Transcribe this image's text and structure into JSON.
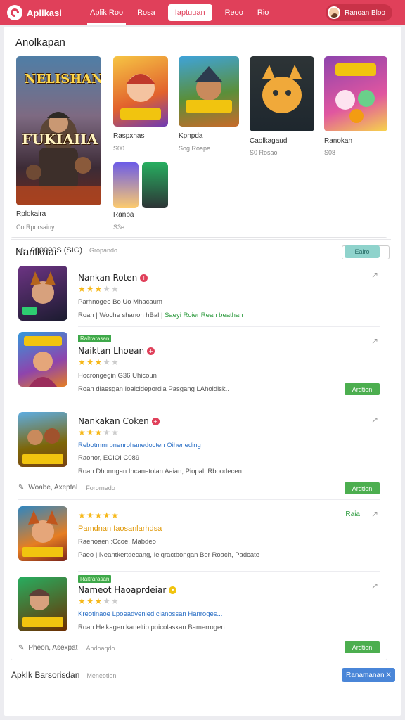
{
  "topbar": {
    "brand": "Aplikasi",
    "nav": [
      "Aplik Roo",
      "Rosa",
      "Iaptuuan",
      "Reoo",
      "Rio"
    ],
    "user": "Ranoan Bloo"
  },
  "featured": {
    "title": "Anolkapan",
    "big": {
      "art_title": "NELISHAN",
      "art_sub": "FUKIAIIA",
      "name": "Rplokaira",
      "meta": "Co Rporsainy"
    },
    "items": [
      {
        "name": "Raspxhas",
        "meta": "S00"
      },
      {
        "name": "Kpnpda",
        "meta": "Sog Roape"
      },
      {
        "name": "Caolkagaud",
        "meta": "S0 Rosao"
      },
      {
        "name": "Ranokan",
        "meta": "S08"
      },
      {
        "name": "Ranba",
        "meta": "S3e"
      }
    ]
  },
  "list": {
    "title": "Nanlkaai",
    "section_button": "Ranoidao",
    "header_text": "000000S (SIG)",
    "header_sub": "Grópando",
    "header_button": "Eairo",
    "rows": [
      {
        "title": "Nankan Roten",
        "rating": 3.5,
        "line1": "Parhnogeo Bo Uo Mhacaum",
        "line2_a": "Roan | Woche shanon hBal |",
        "line2_b": "Saeyi Roier Rean beathan"
      },
      {
        "tag": "Raltrarasan",
        "title": "Naiktan Lhoean",
        "rating": 3,
        "line1": "Hocrongegin G36 Uhicoun",
        "line2": "Roan dlaesgan Ioaicidepordia Pasgang LAhoidisk..",
        "button": "Ardtion"
      },
      {
        "title": "Nankakan Coken",
        "rating": 3,
        "line1": "Rebotmmrbnenrohanedocten Oiheneding",
        "line2": "Raonor, ECIOI C089",
        "line3": "Roan Dhonngan Incanetolan Aaian, Piopal, Rboodecen",
        "footer": "Woabe, Axeptal",
        "footer_sub": "Forornedo",
        "button": "Ardtion"
      },
      {
        "title_a": "Pamdnan",
        "title_b": "Iaosanlarhdsa",
        "rating": 5,
        "line1": "Raehoaen :Ccoe, Mabdeo",
        "line2": "Paeo | Neantkertdecang, Ieiqractbongan Ber Roach, Padcate",
        "tag_right": "Raia"
      },
      {
        "tag": "Raltrarasan",
        "title": "Nameot Haoaprdeiar",
        "rating": 3.5,
        "line1": "Kreotinaoe Lpoeadvenied cianossan Hanroges...",
        "line2": "Roan Heikagen kaneltio poicolaskan Bamerrogen",
        "footer": "Pheon, Asexpat",
        "footer_sub": "Ahdoaqdo",
        "button": "Ardtion"
      }
    ]
  },
  "bottom": {
    "title": "ApkIk Barsorisdan",
    "sub": "Meneotion",
    "button": "Ranamanan X"
  },
  "colors": {
    "brand": "#e0405a",
    "star": "#f6b81a",
    "green": "#4cae4f",
    "blue": "#4a86d8",
    "teal": "#8fd3cc"
  }
}
